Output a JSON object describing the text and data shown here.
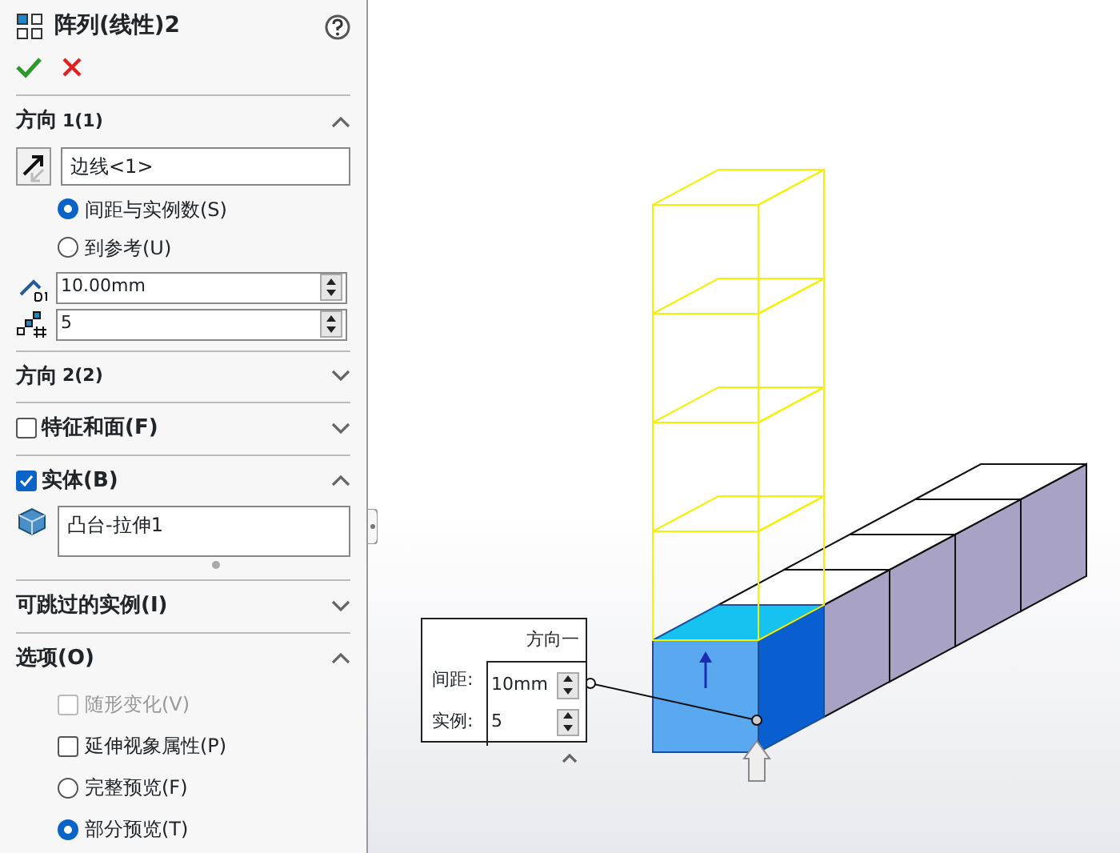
{
  "panel": {
    "title": "阵列(线性)2"
  },
  "sections": [
    {
      "kind": "direction",
      "title": "方向",
      "suffix": "1(1)",
      "expanded": true,
      "edge": "边线<1>",
      "modes": [
        {
          "label": "间距与实例数(S)",
          "selected": true
        },
        {
          "label": "到参考(U)",
          "selected": false
        }
      ],
      "spacing": "10.00mm",
      "instances": "5"
    },
    {
      "title": "方向",
      "suffix": "2(2)",
      "expanded": false
    },
    {
      "title": "特征和面(F)",
      "checked": false,
      "expanded": false
    },
    {
      "kind": "bodies",
      "title": "实体(B)",
      "checked": true,
      "expanded": true,
      "body": "凸台-拉伸1"
    },
    {
      "title": "可跳过的实例(I)",
      "expanded": false
    },
    {
      "kind": "options",
      "title": "选项(O)",
      "expanded": true,
      "items": [
        {
          "kind": "checkbox",
          "label": "随形变化(V)",
          "checked": false,
          "disabled": true
        },
        {
          "kind": "checkbox",
          "label": "延伸视象属性(P)",
          "checked": false,
          "disabled": false
        },
        {
          "kind": "radio",
          "label": "完整预览(F)",
          "selected": false
        },
        {
          "kind": "radio",
          "label": "部分预览(T)",
          "selected": true
        }
      ]
    }
  ],
  "callout": {
    "title": "方向一",
    "fields": [
      {
        "label": "间距:",
        "value": "10mm"
      },
      {
        "label": "实例:",
        "value": "5"
      }
    ]
  }
}
